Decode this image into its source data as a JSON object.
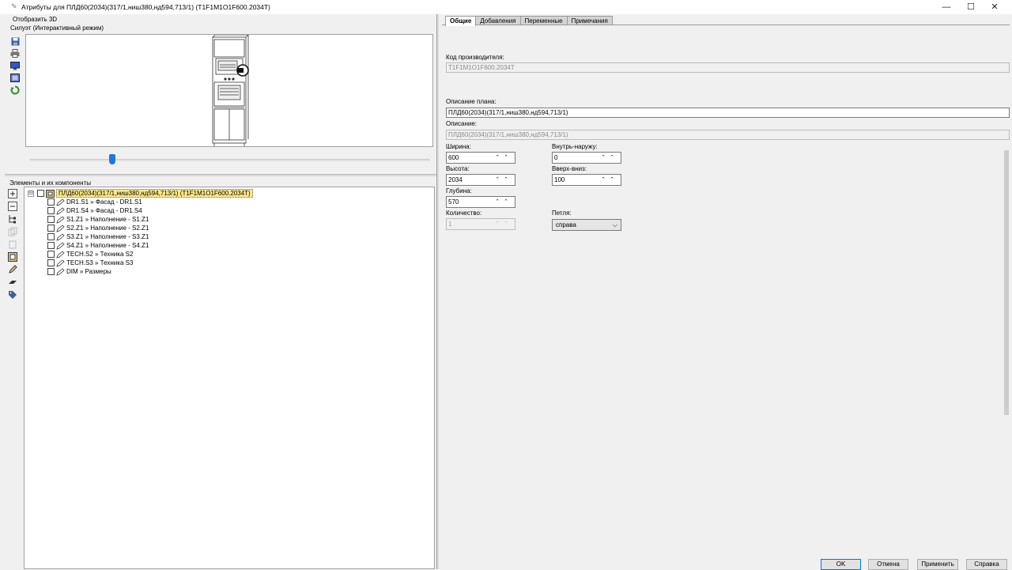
{
  "window": {
    "title": "Атрибуты для ПЛД60(2034)(317/1,ниш380,нд594,713/1) (T1F1M1O1F600.2034T)",
    "minimize": "—",
    "maximize": "☐",
    "close": "✕"
  },
  "left": {
    "show3d": "Отобразить 3D",
    "silhouette_label": "Силуэт (Интерактивный режим)",
    "elements_label": "Элементы и их компоненты",
    "tree": {
      "expander": "⊟",
      "root": "ПЛД60(2034)(317/1,ниш380,нд594,713/1) (T1F1M1O1F600.2034T)",
      "items": [
        "DR1.S1 » Фасад - DR1.S1",
        "DR1.S4 » Фасад - DR1.S4",
        "S1.Z1 » Наполнение - S1.Z1",
        "S2.Z1 » Наполнение - S2.Z1",
        "S3.Z1 » Наполнение - S3.Z1",
        "S4.Z1 » Наполнение - S4.Z1",
        "TECH.S2 » Техника S2",
        "TECH.S3 » Техника S3",
        "DIM » Размеры"
      ]
    },
    "slider_value": 0.2
  },
  "tabs": [
    "Общие",
    "Добавления",
    "Переменные",
    "Примечания"
  ],
  "form": {
    "manufacturer_code_label": "Код производителя:",
    "manufacturer_code": "T1F1M1O1F600.2034T",
    "plan_description_label": "Описание плана:",
    "plan_description": "ПЛД60(2034)(317/1,ниш380,нд594,713/1)",
    "description_label": "Описание:",
    "description": "ПЛД60(2034)(317/1,ниш380,нд594,713/1)",
    "width_label": "Ширина:",
    "width": "600",
    "height_label": "Высота:",
    "height": "2034",
    "depth_label": "Глубина:",
    "depth": "570",
    "quantity_label": "Количество:",
    "quantity": "1",
    "inout_label": "Внутрь-наружу:",
    "inout": "0",
    "updown_label": "Вверх-вниз:",
    "updown": "100",
    "hinge_label": "Петля:",
    "hinge": "справа"
  },
  "buttons": {
    "ok": "OK",
    "cancel": "Отмена",
    "apply": "Применить",
    "help": "Справка"
  }
}
